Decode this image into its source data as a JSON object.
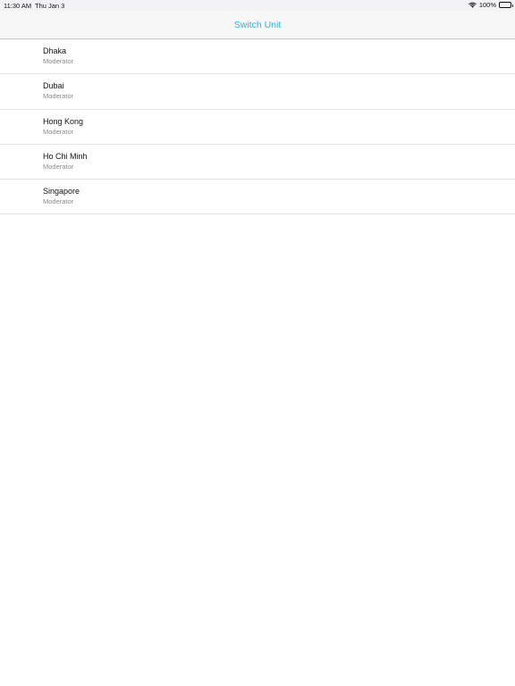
{
  "status_bar": {
    "time": "11:30 AM",
    "date": "Thu Jan 3",
    "battery": "100%",
    "icons": [
      "wifi-icon",
      "battery-icon"
    ]
  },
  "nav": {
    "title": "Switch Unit",
    "title_color": "#2bb5e8"
  },
  "units": [
    {
      "name": "Dhaka",
      "role": "Moderator"
    },
    {
      "name": "Dubai",
      "role": "Moderator"
    },
    {
      "name": "Hong Kong",
      "role": "Moderator"
    },
    {
      "name": "Ho Chi Minh",
      "role": "Moderator"
    },
    {
      "name": "Singapore",
      "role": "Moderator"
    }
  ]
}
